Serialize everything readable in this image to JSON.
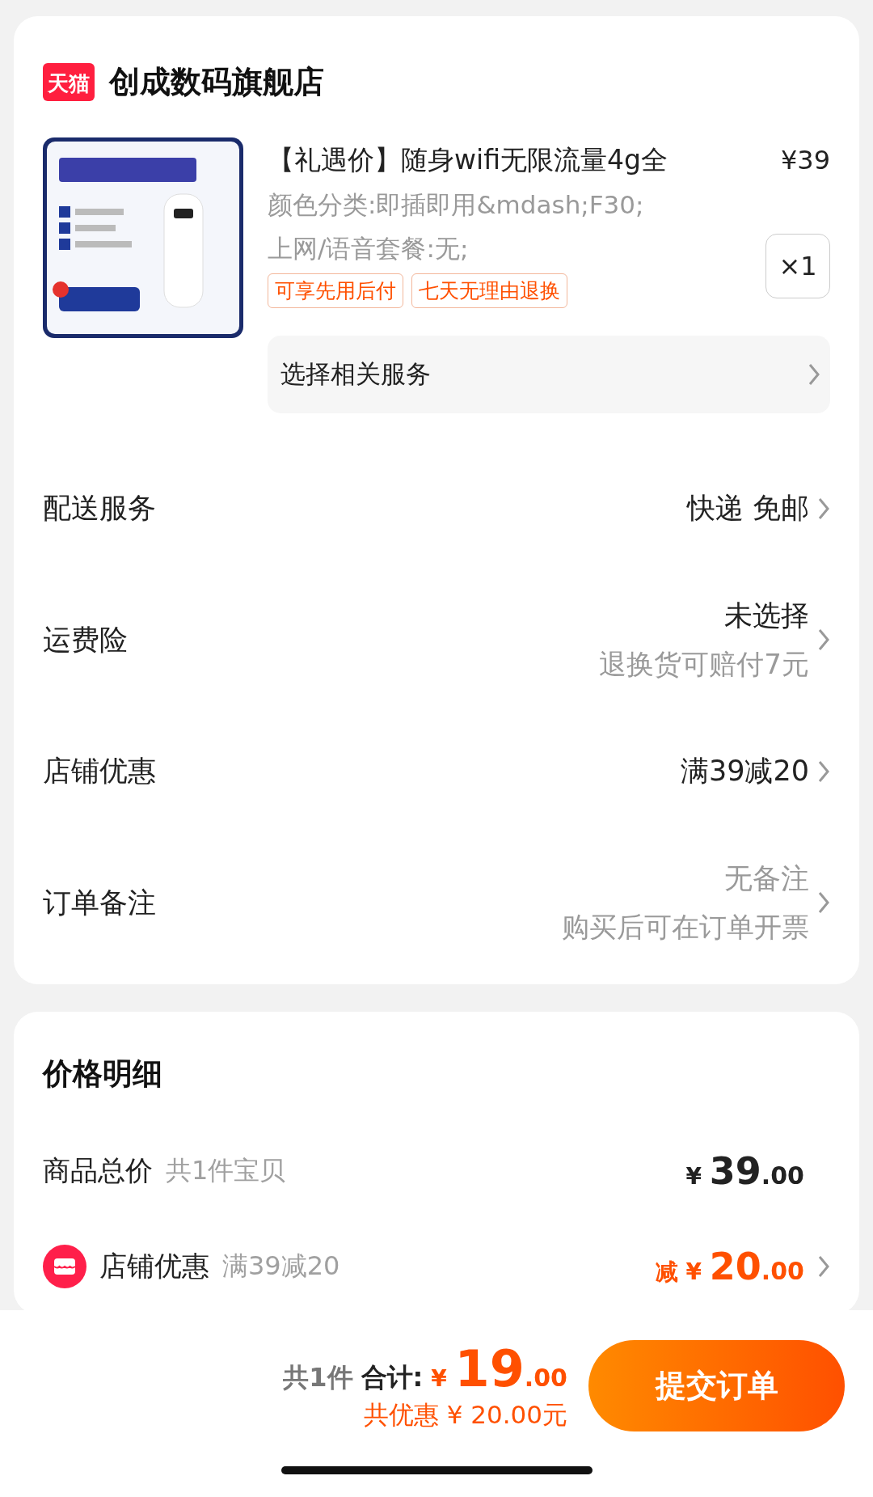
{
  "store": {
    "badge": "天猫",
    "name": "创成数码旗舰店"
  },
  "product": {
    "title": "【礼遇价】随身wifi无限流量4g全",
    "price": "¥39",
    "specs": [
      "颜色分类:即插即用&mdash;F30;",
      "上网/语音套餐:无;"
    ],
    "tags": [
      "可享先用后付",
      "七天无理由退换"
    ],
    "quantity": "×1",
    "service": "选择相关服务"
  },
  "options": [
    {
      "label": "配送服务",
      "values": [
        "快递 免邮"
      ],
      "muted": false
    },
    {
      "label": "运费险",
      "values": [
        "未选择",
        "退换货可赔付7元"
      ],
      "muted": false
    },
    {
      "label": "店铺优惠",
      "values": [
        "满39减20"
      ],
      "muted": false
    },
    {
      "label": "订单备注",
      "values": [
        "无备注",
        "购买后可在订单开票"
      ],
      "muted": true
    }
  ],
  "price_detail": {
    "title": "价格明细",
    "rows": [
      {
        "kind": "total",
        "label": "商品总价",
        "note": "共1件宝贝",
        "prefix": "",
        "currency": "¥",
        "integer": "39",
        "decimal": ".00"
      },
      {
        "kind": "discount",
        "label": "店铺优惠",
        "note": "满39减20",
        "prefix": "减",
        "currency": "¥",
        "integer": "20",
        "decimal": ".00"
      }
    ]
  },
  "footer": {
    "count": "共1件",
    "total_label": "合计:",
    "currency": "¥",
    "integer": "19",
    "decimal": ".00",
    "saving": "共优惠 ¥ 20.00元",
    "submit": "提交订单"
  }
}
